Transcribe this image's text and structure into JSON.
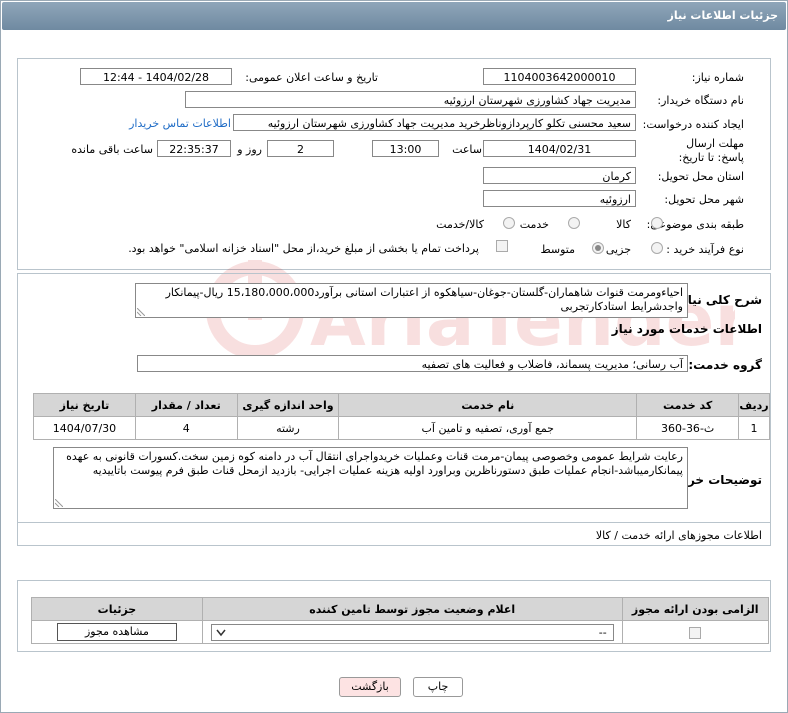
{
  "title": "جزئیات اطلاعات نیاز",
  "fields": {
    "need_number_label": "شماره نیاز:",
    "need_number": "1104003642000010",
    "announce_label": "تاریخ و ساعت اعلان عمومی:",
    "announce_value": "1404/02/28 - 12:44",
    "buyer_org_label": "نام دستگاه خریدار:",
    "buyer_org": "مدیریت جهاد کشاورزی شهرستان ارزوئیه",
    "creator_label": "ایجاد کننده درخواست:",
    "creator": "سعید محسنی تکلو کارپردازوناظرخرید مدیریت جهاد کشاورزی شهرستان ارزوئیه",
    "contact_link": "اطلاعات تماس خریدار",
    "deadline_label": "مهلت ارسال پاسخ: تا تاریخ:",
    "deadline_date": "1404/02/31",
    "time_label": "ساعت",
    "deadline_time": "13:00",
    "days_value": "2",
    "days_label": "روز و",
    "remaining_time": "22:35:37",
    "remaining_label": "ساعت باقی مانده",
    "province_label": "استان محل تحویل:",
    "province": "کرمان",
    "city_label": "شهر محل تحویل:",
    "city": "ارزوئیه",
    "category_label": "طبقه بندی موضوعی:",
    "cat_goods": "کالا",
    "cat_service": "خدمت",
    "cat_goods_service": "کالا/خدمت",
    "process_label": "نوع فرآیند خرید :",
    "proc_partial": "جزیی",
    "proc_medium": "متوسط",
    "payment_note": "پرداخت تمام یا بخشی از مبلغ خرید،از محل \"اسناد خزانه اسلامی\" خواهد بود."
  },
  "summary": {
    "label": "شرح کلی نیاز:",
    "text": "احیاءومرمت قنوات شاهماران-گلستان-جوغان-سیاهکوه از اعتبارات استانی برآورد15،180،000،000 ریال-پیمانکار واجدشرایط استادکارتجربی"
  },
  "services_title": "اطلاعات خدمات مورد نیاز",
  "service_group": {
    "label": "گروه خدمت:",
    "value": "آب رسانی؛ مدیریت پسماند، فاضلاب و فعالیت های تصفیه"
  },
  "table": {
    "headers": [
      "ردیف",
      "کد خدمت",
      "نام خدمت",
      "واحد اندازه گیری",
      "تعداد / مقدار",
      "تاریخ نیاز"
    ],
    "rows": [
      [
        "1",
        "ث-36-360",
        "جمع آوری، تصفیه و تامین آب",
        "رشته",
        "4",
        "1404/07/30"
      ]
    ]
  },
  "buyer_notes": {
    "label": "توضیحات خریدار:",
    "text": "رعایت شرایط عمومی وخصوصی پیمان-مرمت قنات وعملیات خریدواجرای انتقال آب در دامنه کوه زمین سخت.کسورات قانونی به عهده پیمانکارمیباشد-انجام عملیات طبق دستورناظرین وبراورد اولیه هزینه عملیات اجرایی- بازدید ازمحل قنات طبق فرم پیوست باتاییدیه"
  },
  "permits": {
    "title": "اطلاعات مجوزهای ارائه خدمت / کالا",
    "headers": [
      "الزامی بودن ارائه مجوز",
      "اعلام وضعیت مجوز توسط تامین کننده",
      "جزئیات"
    ],
    "select_value": "--",
    "view_button": "مشاهده مجوز"
  },
  "buttons": {
    "print": "چاپ",
    "back": "بازگشت"
  },
  "watermark": "AriaTender.neT"
}
